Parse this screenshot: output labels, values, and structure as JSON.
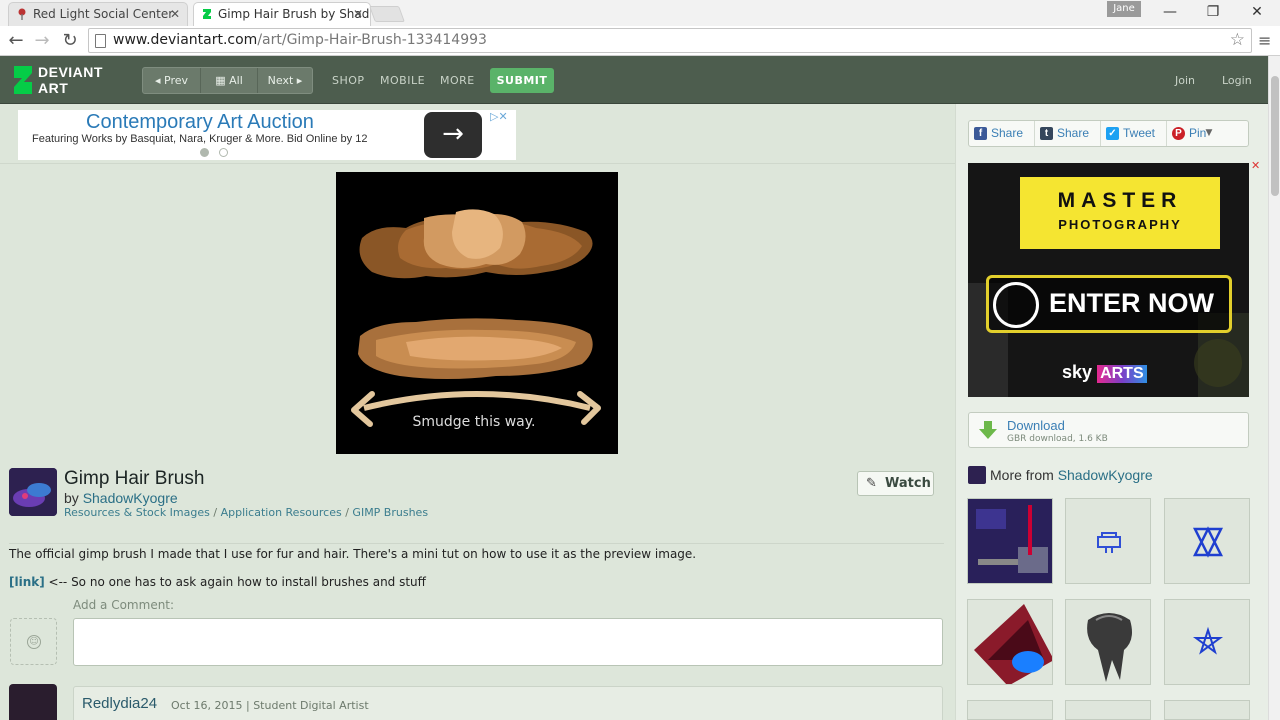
{
  "browser": {
    "tabs": [
      {
        "title": "Red Light Social Center",
        "active": false
      },
      {
        "title": "Gimp Hair Brush by Shado",
        "active": true
      }
    ],
    "tab_close": "✕",
    "profile_name": "Jane",
    "window_controls": {
      "minimize": "—",
      "maximize": "❐",
      "close": "✕"
    },
    "url_host": "www.deviantart.com",
    "url_path": "/art/Gimp-Hair-Brush-133414993",
    "back": "←",
    "forward": "→",
    "reload": "↻",
    "star": "☆",
    "menu": "≡"
  },
  "header": {
    "logo_line1": "DEVIANT",
    "logo_line2": "ART",
    "prev": "◂ Prev",
    "all": "▦ All",
    "next": "Next ▸",
    "shop": "SHOP",
    "mobile": "MOBILE",
    "more": "MORE",
    "submit": "SUBMIT",
    "join": "Join",
    "login": "Login"
  },
  "ad": {
    "title": "Contemporary Art Auction",
    "subtitle": "Featuring Works by Basquiat, Nara, Kruger & More. Bid Online by 12",
    "arrow": "→",
    "choices": "▷✕"
  },
  "artwork": {
    "caption": "Smudge this way."
  },
  "deviation": {
    "title": "Gimp Hair Brush",
    "by": "by",
    "author": "ShadowKyogre",
    "breadcrumb": [
      "Resources & Stock Images",
      "Application Resources",
      "GIMP Brushes"
    ],
    "breadcrumb_sep": " / ",
    "watch": "Watch",
    "watch_icon": "✎",
    "description": "The official gimp brush I made that I use for fur and hair. There's a mini tut on how to use it as the preview image.",
    "link_label": "[link]",
    "link_text": " <-- So no one has to ask again how to install brushes and stuff"
  },
  "comments": {
    "add_label": "Add a Comment:",
    "smiley": "☺",
    "first": {
      "user": "Redlydia24",
      "date": "Oct 16, 2015",
      "role": "Student Digital Artist",
      "sep": " | "
    }
  },
  "sidebar": {
    "share": [
      {
        "label": "Share",
        "icon": "f",
        "color": "#3b5998"
      },
      {
        "label": "Share",
        "icon": "t",
        "color": "#35465c"
      },
      {
        "label": "Tweet",
        "icon": "✓",
        "color": "#1da1f2"
      },
      {
        "label": "Pin",
        "icon": "P",
        "color": "#cb2027"
      }
    ],
    "share_more": "▼",
    "ad_close": "✕",
    "bigad": {
      "line1": "MASTER",
      "line2": "PHOTOGRAPHY",
      "cta": "ENTER NOW",
      "brand_sky": "sky",
      "brand_arts": "ARTS"
    },
    "download_label": "Download",
    "download_meta": "GBR download, 1.6 KB",
    "more_from_label": "More from ",
    "more_from_user": "ShadowKyogre"
  },
  "colors": {
    "header_bg": "#4d5d4e",
    "page_bg": "#dde6da",
    "submit_green": "#5ab369",
    "link_blue": "#3b7fb5"
  }
}
